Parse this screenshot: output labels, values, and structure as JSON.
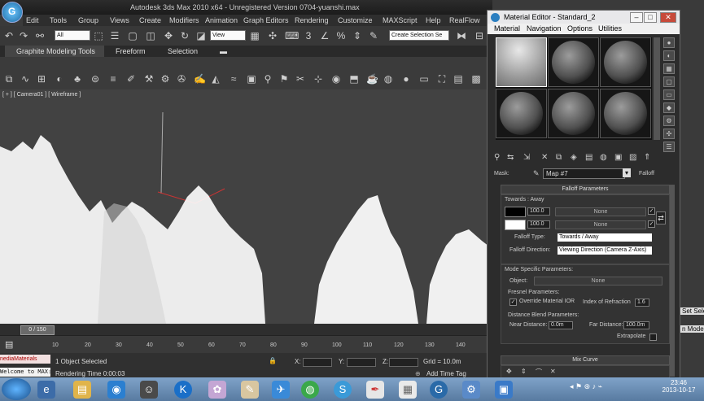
{
  "max_window": {
    "title": "Autodesk 3ds Max  2010 x64  -  Unregistered Version    0704-yuanshi.max",
    "menus": [
      "Edit",
      "Tools",
      "Group",
      "Views",
      "Create",
      "Modifiers",
      "Animation",
      "Graph Editors",
      "Rendering",
      "Customize",
      "MAXScript",
      "Help",
      "RealFlow"
    ],
    "selection_filter": "All",
    "ref_coord": "View",
    "selection_set_placeholder": "Create Selection Se",
    "ribbon_tabs": [
      "Graphite Modeling Tools",
      "Freeform",
      "Selection"
    ],
    "viewport_label": "[ + ] [ Camera01 ] [ Wireframe ]"
  },
  "timeline": {
    "frame": "0 / 150",
    "ticks": [
      "10",
      "20",
      "30",
      "40",
      "50",
      "60",
      "70",
      "80",
      "90",
      "100",
      "110",
      "120",
      "130",
      "140"
    ]
  },
  "status": {
    "maxscript_line1": "nediaMaterials",
    "maxscript_line2": "Welcome to MAX:",
    "selected": "1 Object Selected",
    "render_time": "Rendering Time  0:00:03",
    "x_label": "X:",
    "y_label": "Y:",
    "z_label": "Z:",
    "grid": "Grid = 10.0m",
    "add_time_tag": "Add Time Tag",
    "right_edge_1": "Set Sele",
    "right_edge_2": "n Mode"
  },
  "material_editor": {
    "title": "Material Editor - Standard_2",
    "menus": [
      "Material",
      "Navigation",
      "Options",
      "Utilities"
    ],
    "mask_label": "Mask:",
    "map_name": "Map #7",
    "map_type": "Falloff",
    "falloff_rollout": "Falloff Parameters",
    "towards_away": "Towards : Away",
    "color1_value": "100.0",
    "color2_value": "100.0",
    "map_slot_1": "None",
    "map_slot_2": "None",
    "falloff_type_label": "Falloff Type:",
    "falloff_type_value": "Towards / Away",
    "falloff_direction_label": "Falloff Direction:",
    "falloff_direction_value": "Viewing Direction (Camera Z-Axis)",
    "mode_specific": "Mode Specific Parameters:",
    "object_label": "Object:",
    "object_value": "None",
    "fresnel_params": "Fresnel Parameters:",
    "override_ior": "Override Material IOR",
    "index_refraction_label": "Index of Refraction",
    "index_refraction_value": "1.6",
    "distance_blend": "Distance Blend Parameters:",
    "near_distance_label": "Near Distance:",
    "near_distance_value": "0.0m",
    "far_distance_label": "Far Distance:",
    "far_distance_value": "100.0m",
    "extrapolate_label": "Extrapolate",
    "mix_curve": "Mix Curve"
  },
  "taskbar": {
    "time": "23:46",
    "date": "2013-10-17"
  }
}
